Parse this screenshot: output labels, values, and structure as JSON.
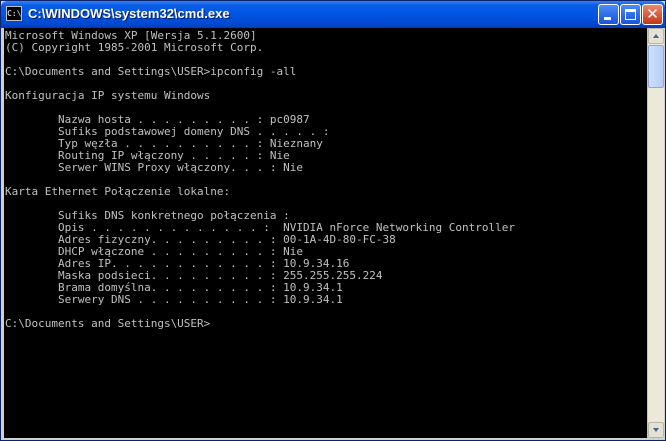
{
  "window": {
    "title": "C:\\WINDOWS\\system32\\cmd.exe",
    "icon_label": "C:\\",
    "icon": "cmd-icon",
    "buttons": [
      "minimize-icon",
      "maximize-icon",
      "close-icon"
    ],
    "colors": {
      "console_background": "#000000",
      "console_text": "#c0c0c0",
      "titlebar": "#0054e3"
    }
  },
  "console": {
    "lines": [
      "Microsoft Windows XP [Wersja 5.1.2600]",
      "(C) Copyright 1985-2001 Microsoft Corp.",
      "",
      "C:\\Documents and Settings\\USER>ipconfig -all",
      "",
      "Konfiguracja IP systemu Windows",
      "",
      "        Nazwa hosta . . . . . . . . . : pc0987",
      "        Sufiks podstawowej domeny DNS . . . . . :",
      "        Typ węzła . . . . . . . . . . : Nieznany",
      "        Routing IP włączony . . . . . : Nie",
      "        Serwer WINS Proxy włączony. . . : Nie",
      "",
      "Karta Ethernet Połączenie lokalne:",
      "",
      "        Sufiks DNS konkretnego połączenia :",
      "        Opis . . . . . . . . . . . . . :  NVIDIA nForce Networking Controller",
      "        Adres fizyczny. . . . . . . . . : 00-1A-4D-80-FC-38",
      "        DHCP włączone . . . . . . . . . : Nie",
      "        Adres IP. . . . . . . . . . . . : 10.9.34.16",
      "        Maska podsieci. . . . . . . . . : 255.255.255.224",
      "        Brama domyślna. . . . . . . . . : 10.9.34.1",
      "        Serwery DNS . . . . . . . . . . : 10.9.34.1",
      "",
      "C:\\Documents and Settings\\USER>"
    ]
  }
}
